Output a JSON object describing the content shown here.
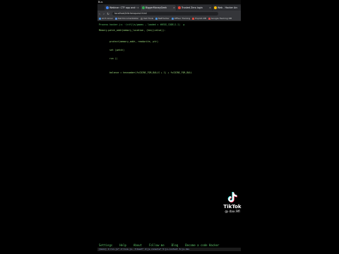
{
  "os_topbar": {
    "label": "Bus"
  },
  "tabs": [
    {
      "label": "Webinar: CTF app and s...",
      "color": "#4285f4",
      "active": false
    },
    {
      "label": "BiggerMoneyGeek",
      "color": "#34a853",
      "active": true
    },
    {
      "label": "Trusted Zero login",
      "color": "#ea4335",
      "active": false
    },
    {
      "label": "Web - Hacker Arc",
      "color": "#fbbc05",
      "active": false
    }
  ],
  "address_bar": {
    "url": "localhost/kitchenquest.html"
  },
  "bookmarks": [
    {
      "label": "Arch Linux",
      "color": "#4a90d9"
    },
    {
      "label": "Kali Documentation",
      "color": "#5b8dd6"
    },
    {
      "label": "Kali Tools",
      "color": "#6a6a6a"
    },
    {
      "label": "NetHunter",
      "color": "#4a90d9"
    },
    {
      "label": "OffSec Training",
      "color": "#4a90d9"
    },
    {
      "label": "Exploit-DB",
      "color": "#e84a3a"
    },
    {
      "label": "Google Hacking DB",
      "color": "#d94a4a"
    }
  ],
  "terminal_lines": [
    {
      "text": "Process hacker.js: ~/ctf/js/games — loaded × tHEGG_CODE(1.1)  ◀",
      "color": "#5fc46a",
      "indent": 0,
      "row": 0
    },
    {
      "text": "Memory.patch_addr(memory_location, (hex)(value)):",
      "color": "#9ad67a",
      "indent": 0,
      "row": 2
    },
    {
      "text": "protect(memory_addr, readwrite, ptr)",
      "color": "#9ad67a",
      "indent": 5,
      "row": 6
    },
    {
      "text": "set (patch)",
      "color": "#9ad67a",
      "indent": 5,
      "row": 9
    },
    {
      "text": "run ()",
      "color": "#9ad67a",
      "indent": 5,
      "row": 12
    },
    {
      "text": "balance = hexnumber(fsCOINS_FOR_BALLS + 1) + fsCOINS_FOR_BALL",
      "color": "#9ad67a",
      "indent": 5,
      "row": 17
    }
  ],
  "bottom_menu": [
    "Settings",
    "Help",
    "About",
    "Follow me",
    "Blog",
    "Become a code Hacker"
  ],
  "statusbar": "[main] 1:run.js* 2:live.js- 3:bash* 4:js-console* 5:js-context 6:js-dev",
  "watermark": {
    "brand": "TikTok",
    "handle": "@ dax.9fl"
  }
}
